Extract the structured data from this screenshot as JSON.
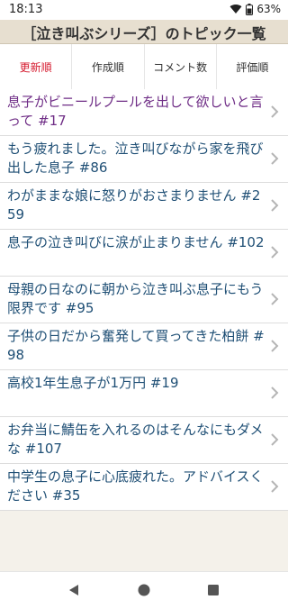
{
  "status": {
    "time": "18:13",
    "battery": "63%"
  },
  "header": {
    "title": "［泣き叫ぶシリーズ］のトピック一覧"
  },
  "tabs": [
    {
      "label": "更新順",
      "active": true
    },
    {
      "label": "作成順",
      "active": false
    },
    {
      "label": "コメント数",
      "active": false
    },
    {
      "label": "評価順",
      "active": false
    }
  ],
  "topics": [
    {
      "title": "息子がビニールプールを出して欲しいと言って #17",
      "visited": true
    },
    {
      "title": "もう疲れました。泣き叫びながら家を飛び出した息子 #86",
      "visited": false
    },
    {
      "title": "わがままな娘に怒りがおさまりません #259",
      "visited": false
    },
    {
      "title": "息子の泣き叫びに涙が止まりません #102",
      "visited": false
    },
    {
      "title": "母親の日なのに朝から泣き叫ぶ息子にもう限界です #95",
      "visited": false
    },
    {
      "title": "子供の日だから奮発して買ってきた柏餅 #98",
      "visited": false
    },
    {
      "title": "高校1年生息子が1万円 #19",
      "visited": false
    },
    {
      "title": "お弁当に鯖缶を入れるのはそんなにもダメな #107",
      "visited": false
    },
    {
      "title": "中学生の息子に心底疲れた。アドバイスください #35",
      "visited": false
    }
  ],
  "icons": {
    "chevron": "chevron-right-icon",
    "back": "back-triangle-icon",
    "home": "home-circle-icon",
    "recent": "recent-square-icon"
  },
  "colors": {
    "accent": "#d51b2f",
    "link": "#1f4f75",
    "visited": "#6f2d86",
    "header_bg": "#e7dfd0"
  }
}
